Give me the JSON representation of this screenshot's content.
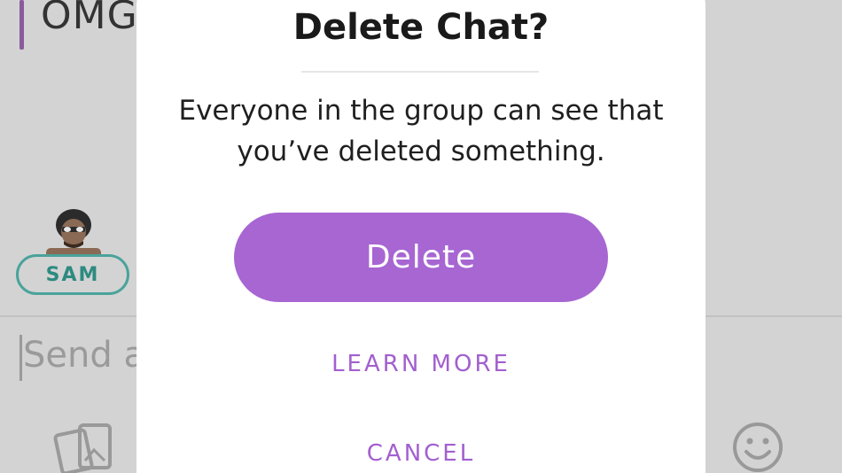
{
  "chat": {
    "message_preview": "OMG",
    "sender_name": "SAM",
    "input_placeholder": "Send a"
  },
  "dialog": {
    "title": "Delete Chat?",
    "body_line1": "Everyone in the group can see that",
    "body_line2": "you’ve deleted something.",
    "delete_label": "Delete",
    "learn_more_label": "LEARN MORE",
    "cancel_label": "CANCEL"
  },
  "icons": {
    "avatar": "bitmoji-avatar",
    "camera_roll": "camera-roll-icon",
    "emoji": "smiley-icon"
  },
  "colors": {
    "accent": "#a766d2",
    "link": "#a260cf",
    "chip": "#4aa39a",
    "overlay": "#d3d3d3"
  }
}
